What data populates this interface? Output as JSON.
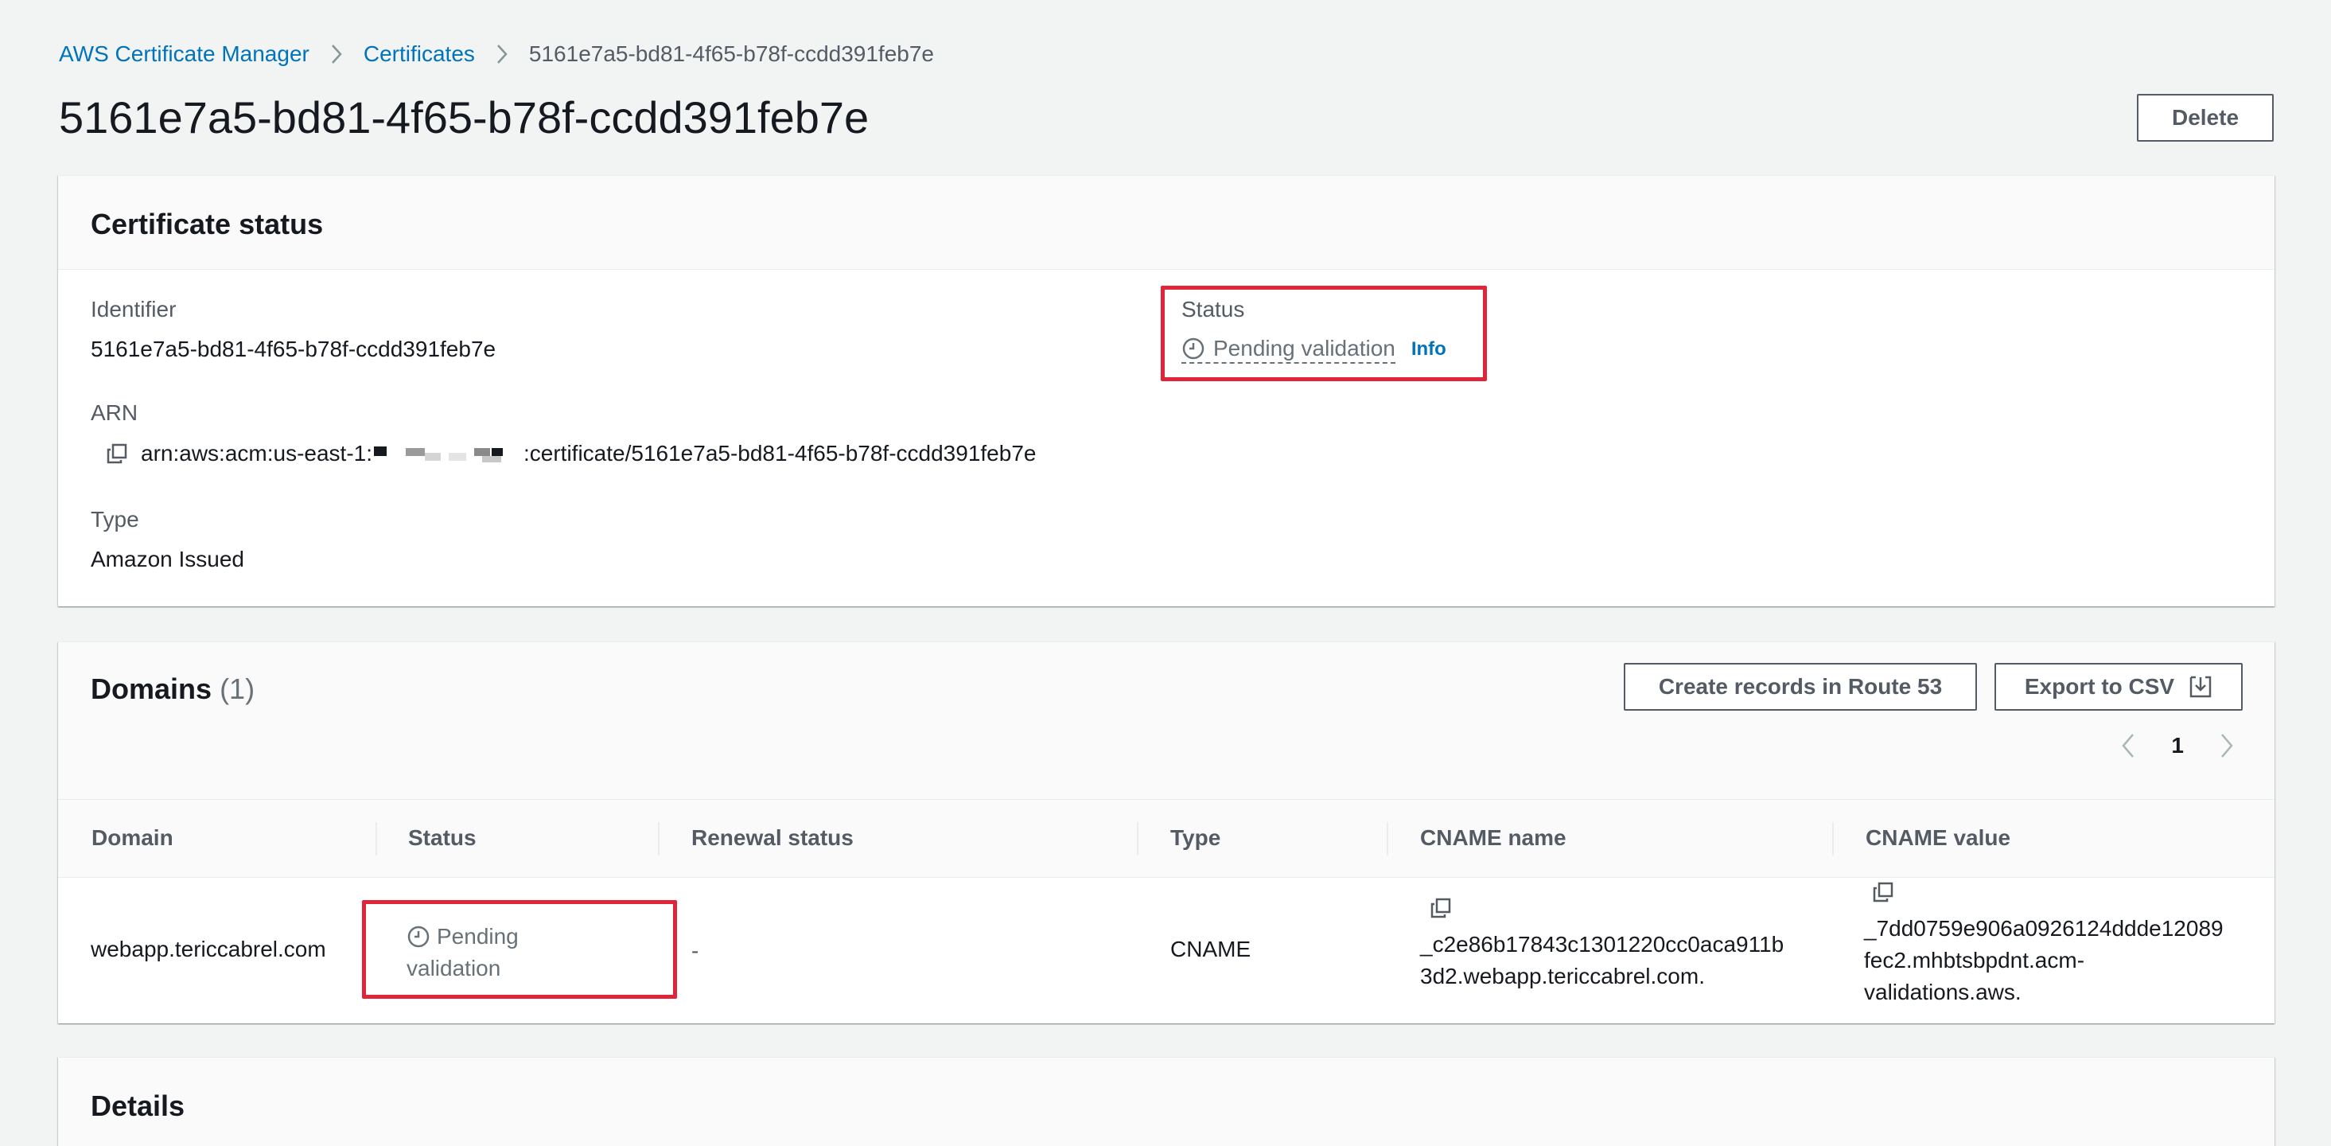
{
  "breadcrumb": {
    "items": [
      "AWS Certificate Manager",
      "Certificates"
    ],
    "current": "5161e7a5-bd81-4f65-b78f-ccdd391feb7e"
  },
  "page": {
    "title": "5161e7a5-bd81-4f65-b78f-ccdd391feb7e",
    "delete_label": "Delete"
  },
  "certificate_status": {
    "title": "Certificate status",
    "identifier_label": "Identifier",
    "identifier_value": "5161e7a5-bd81-4f65-b78f-ccdd391feb7e",
    "arn_label": "ARN",
    "arn_prefix": "arn:aws:acm:us-east-1:",
    "arn_suffix": ":certificate/5161e7a5-bd81-4f65-b78f-ccdd391feb7e",
    "type_label": "Type",
    "type_value": "Amazon Issued",
    "status_label": "Status",
    "status_value": "Pending validation",
    "info_label": "Info"
  },
  "domains": {
    "title": "Domains",
    "count": "(1)",
    "create_records_label": "Create records in Route 53",
    "export_label": "Export to CSV",
    "page_number": "1",
    "columns": [
      "Domain",
      "Status",
      "Renewal status",
      "Type",
      "CNAME name",
      "CNAME value"
    ],
    "rows": [
      {
        "domain": "webapp.tericcabrel.com",
        "status_line1": "Pending",
        "status_line2": "validation",
        "renewal_status": "-",
        "type": "CNAME",
        "cname_name_line1": "_c2e86b17843c1301220cc0aca911b",
        "cname_name_line2": "3d2.webapp.tericcabrel.com.",
        "cname_value_line1": "_7dd0759e906a0926124ddde12089",
        "cname_value_line2": "fec2.mhbtsbpdnt.acm-",
        "cname_value_line3": "validations.aws."
      }
    ]
  },
  "details": {
    "title": "Details"
  },
  "colors": {
    "link": "#0073bb",
    "highlight": "#e0243a",
    "pending": "#687078"
  }
}
